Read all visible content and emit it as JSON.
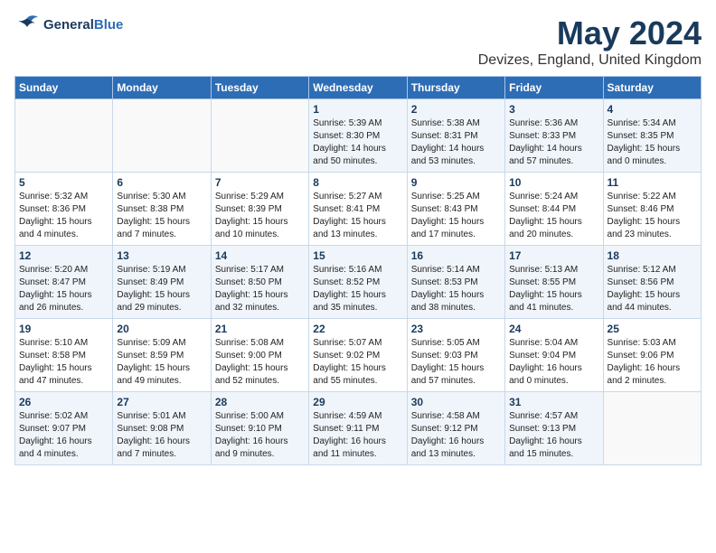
{
  "header": {
    "logo_line1": "General",
    "logo_line2": "Blue",
    "title": "May 2024",
    "subtitle": "Devizes, England, United Kingdom"
  },
  "days_of_week": [
    "Sunday",
    "Monday",
    "Tuesday",
    "Wednesday",
    "Thursday",
    "Friday",
    "Saturday"
  ],
  "weeks": [
    [
      {
        "day": "",
        "info": ""
      },
      {
        "day": "",
        "info": ""
      },
      {
        "day": "",
        "info": ""
      },
      {
        "day": "1",
        "info": "Sunrise: 5:39 AM\nSunset: 8:30 PM\nDaylight: 14 hours\nand 50 minutes."
      },
      {
        "day": "2",
        "info": "Sunrise: 5:38 AM\nSunset: 8:31 PM\nDaylight: 14 hours\nand 53 minutes."
      },
      {
        "day": "3",
        "info": "Sunrise: 5:36 AM\nSunset: 8:33 PM\nDaylight: 14 hours\nand 57 minutes."
      },
      {
        "day": "4",
        "info": "Sunrise: 5:34 AM\nSunset: 8:35 PM\nDaylight: 15 hours\nand 0 minutes."
      }
    ],
    [
      {
        "day": "5",
        "info": "Sunrise: 5:32 AM\nSunset: 8:36 PM\nDaylight: 15 hours\nand 4 minutes."
      },
      {
        "day": "6",
        "info": "Sunrise: 5:30 AM\nSunset: 8:38 PM\nDaylight: 15 hours\nand 7 minutes."
      },
      {
        "day": "7",
        "info": "Sunrise: 5:29 AM\nSunset: 8:39 PM\nDaylight: 15 hours\nand 10 minutes."
      },
      {
        "day": "8",
        "info": "Sunrise: 5:27 AM\nSunset: 8:41 PM\nDaylight: 15 hours\nand 13 minutes."
      },
      {
        "day": "9",
        "info": "Sunrise: 5:25 AM\nSunset: 8:43 PM\nDaylight: 15 hours\nand 17 minutes."
      },
      {
        "day": "10",
        "info": "Sunrise: 5:24 AM\nSunset: 8:44 PM\nDaylight: 15 hours\nand 20 minutes."
      },
      {
        "day": "11",
        "info": "Sunrise: 5:22 AM\nSunset: 8:46 PM\nDaylight: 15 hours\nand 23 minutes."
      }
    ],
    [
      {
        "day": "12",
        "info": "Sunrise: 5:20 AM\nSunset: 8:47 PM\nDaylight: 15 hours\nand 26 minutes."
      },
      {
        "day": "13",
        "info": "Sunrise: 5:19 AM\nSunset: 8:49 PM\nDaylight: 15 hours\nand 29 minutes."
      },
      {
        "day": "14",
        "info": "Sunrise: 5:17 AM\nSunset: 8:50 PM\nDaylight: 15 hours\nand 32 minutes."
      },
      {
        "day": "15",
        "info": "Sunrise: 5:16 AM\nSunset: 8:52 PM\nDaylight: 15 hours\nand 35 minutes."
      },
      {
        "day": "16",
        "info": "Sunrise: 5:14 AM\nSunset: 8:53 PM\nDaylight: 15 hours\nand 38 minutes."
      },
      {
        "day": "17",
        "info": "Sunrise: 5:13 AM\nSunset: 8:55 PM\nDaylight: 15 hours\nand 41 minutes."
      },
      {
        "day": "18",
        "info": "Sunrise: 5:12 AM\nSunset: 8:56 PM\nDaylight: 15 hours\nand 44 minutes."
      }
    ],
    [
      {
        "day": "19",
        "info": "Sunrise: 5:10 AM\nSunset: 8:58 PM\nDaylight: 15 hours\nand 47 minutes."
      },
      {
        "day": "20",
        "info": "Sunrise: 5:09 AM\nSunset: 8:59 PM\nDaylight: 15 hours\nand 49 minutes."
      },
      {
        "day": "21",
        "info": "Sunrise: 5:08 AM\nSunset: 9:00 PM\nDaylight: 15 hours\nand 52 minutes."
      },
      {
        "day": "22",
        "info": "Sunrise: 5:07 AM\nSunset: 9:02 PM\nDaylight: 15 hours\nand 55 minutes."
      },
      {
        "day": "23",
        "info": "Sunrise: 5:05 AM\nSunset: 9:03 PM\nDaylight: 15 hours\nand 57 minutes."
      },
      {
        "day": "24",
        "info": "Sunrise: 5:04 AM\nSunset: 9:04 PM\nDaylight: 16 hours\nand 0 minutes."
      },
      {
        "day": "25",
        "info": "Sunrise: 5:03 AM\nSunset: 9:06 PM\nDaylight: 16 hours\nand 2 minutes."
      }
    ],
    [
      {
        "day": "26",
        "info": "Sunrise: 5:02 AM\nSunset: 9:07 PM\nDaylight: 16 hours\nand 4 minutes."
      },
      {
        "day": "27",
        "info": "Sunrise: 5:01 AM\nSunset: 9:08 PM\nDaylight: 16 hours\nand 7 minutes."
      },
      {
        "day": "28",
        "info": "Sunrise: 5:00 AM\nSunset: 9:10 PM\nDaylight: 16 hours\nand 9 minutes."
      },
      {
        "day": "29",
        "info": "Sunrise: 4:59 AM\nSunset: 9:11 PM\nDaylight: 16 hours\nand 11 minutes."
      },
      {
        "day": "30",
        "info": "Sunrise: 4:58 AM\nSunset: 9:12 PM\nDaylight: 16 hours\nand 13 minutes."
      },
      {
        "day": "31",
        "info": "Sunrise: 4:57 AM\nSunset: 9:13 PM\nDaylight: 16 hours\nand 15 minutes."
      },
      {
        "day": "",
        "info": ""
      }
    ]
  ]
}
